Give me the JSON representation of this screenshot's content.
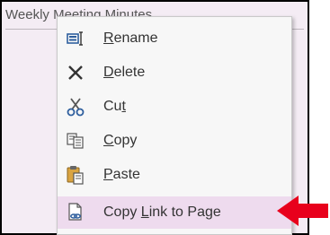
{
  "page": {
    "title": "Weekly Meeting Minutes"
  },
  "menu": {
    "items": [
      {
        "name": "rename",
        "label": "Rename",
        "icon": "rename-icon",
        "access_key_index": 0
      },
      {
        "name": "delete",
        "label": "Delete",
        "icon": "delete-icon",
        "access_key_index": 0
      },
      {
        "name": "cut",
        "label": "Cut",
        "icon": "scissors-icon",
        "access_key_index": 2
      },
      {
        "name": "copy",
        "label": "Copy",
        "icon": "copy-icon",
        "access_key_index": 0
      },
      {
        "name": "paste",
        "label": "Paste",
        "icon": "paste-icon",
        "access_key_index": 0
      },
      {
        "name": "copy-link-to-page",
        "label": "Copy Link to Page",
        "icon": "link-page-icon",
        "access_key_index": 5,
        "highlighted": true
      }
    ]
  },
  "colors": {
    "highlight": "#eedbee",
    "arrow": "#e8001c",
    "page_background": "#f4ecf4"
  }
}
